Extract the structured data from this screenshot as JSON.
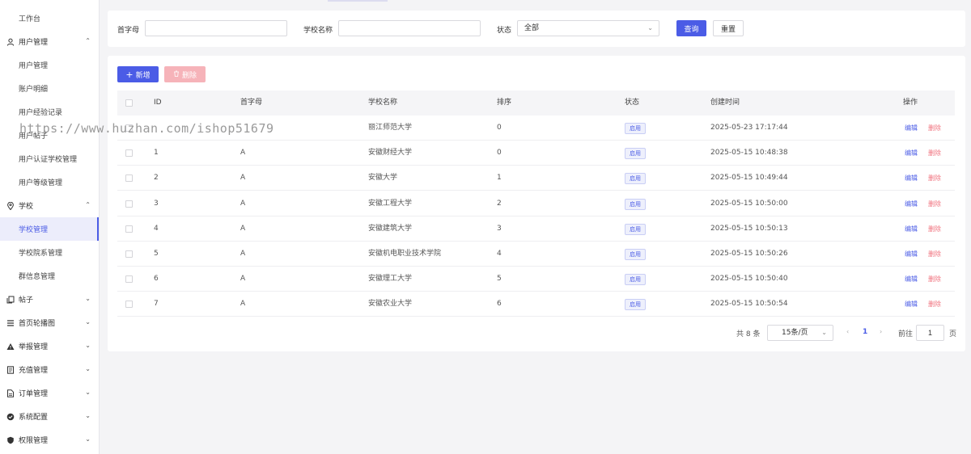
{
  "sidebar": {
    "top_item": "工作台",
    "groups": [
      {
        "label": "用户管理",
        "icon": "user-icon",
        "expanded": true
      },
      {
        "label": "学校",
        "icon": "location-pin-icon",
        "expanded": true
      },
      {
        "label": "帖子",
        "icon": "copy-icon",
        "expanded": false
      },
      {
        "label": "首页轮播图",
        "icon": "menu-lines-icon",
        "expanded": false
      },
      {
        "label": "举报管理",
        "icon": "warning-icon",
        "expanded": false
      },
      {
        "label": "充值管理",
        "icon": "document-icon",
        "expanded": false
      },
      {
        "label": "订单管理",
        "icon": "file-icon",
        "expanded": false
      },
      {
        "label": "系统配置",
        "icon": "check-circle-icon",
        "expanded": false
      },
      {
        "label": "权限管理",
        "icon": "shield-icon",
        "expanded": false
      }
    ],
    "user_items": [
      "用户管理",
      "账户明细",
      "用户经验记录",
      "用户帖子",
      "用户认证学校管理",
      "用户等级管理"
    ],
    "school_items": [
      "学校管理",
      "学校院系管理",
      "群信息管理"
    ],
    "active_item": "学校管理",
    "chevron_up": "⌃",
    "chevron_down": "⌄"
  },
  "watermark": "https://www.huzhan.com/ishop51679",
  "search": {
    "initial_label": "首字母",
    "initial_value": "",
    "school_label": "学校名称",
    "school_value": "",
    "status_label": "状态",
    "status_value": "全部",
    "query_button": "查询",
    "reset_button": "重置"
  },
  "toolbar": {
    "add_label": "新增",
    "delete_label": "删除"
  },
  "table": {
    "headers": [
      "ID",
      "首字母",
      "学校名称",
      "排序",
      "状态",
      "创建时间",
      "操作"
    ],
    "rows": [
      {
        "id": "",
        "initial": "",
        "name": "丽江师范大学",
        "sort": "0",
        "status": "启用",
        "created": "2025-05-23 17:17:44",
        "edit": "编辑",
        "delete": "删除"
      },
      {
        "id": "1",
        "initial": "A",
        "name": "安徽财经大学",
        "sort": "0",
        "status": "启用",
        "created": "2025-05-15 10:48:38",
        "edit": "编辑",
        "delete": "删除"
      },
      {
        "id": "2",
        "initial": "A",
        "name": "安徽大学",
        "sort": "1",
        "status": "启用",
        "created": "2025-05-15 10:49:44",
        "edit": "编辑",
        "delete": "删除"
      },
      {
        "id": "3",
        "initial": "A",
        "name": "安徽工程大学",
        "sort": "2",
        "status": "启用",
        "created": "2025-05-15 10:50:00",
        "edit": "编辑",
        "delete": "删除"
      },
      {
        "id": "4",
        "initial": "A",
        "name": "安徽建筑大学",
        "sort": "3",
        "status": "启用",
        "created": "2025-05-15 10:50:13",
        "edit": "编辑",
        "delete": "删除"
      },
      {
        "id": "5",
        "initial": "A",
        "name": "安徽机电职业技术学院",
        "sort": "4",
        "status": "启用",
        "created": "2025-05-15 10:50:26",
        "edit": "编辑",
        "delete": "删除"
      },
      {
        "id": "6",
        "initial": "A",
        "name": "安徽理工大学",
        "sort": "5",
        "status": "启用",
        "created": "2025-05-15 10:50:40",
        "edit": "编辑",
        "delete": "删除"
      },
      {
        "id": "7",
        "initial": "A",
        "name": "安徽农业大学",
        "sort": "6",
        "status": "启用",
        "created": "2025-05-15 10:50:54",
        "edit": "编辑",
        "delete": "删除"
      }
    ]
  },
  "pagination": {
    "total": "共 8 条",
    "page_size": "15条/页",
    "current_page": "1",
    "goto_label": "前往",
    "goto_value": "1",
    "page_unit": "页",
    "prev": "‹",
    "next": "›"
  },
  "colors": {
    "primary": "#4b5ce6",
    "danger": "#f0727e",
    "danger_disabled": "#f6b3b9",
    "active_bg": "#ecedfb"
  }
}
